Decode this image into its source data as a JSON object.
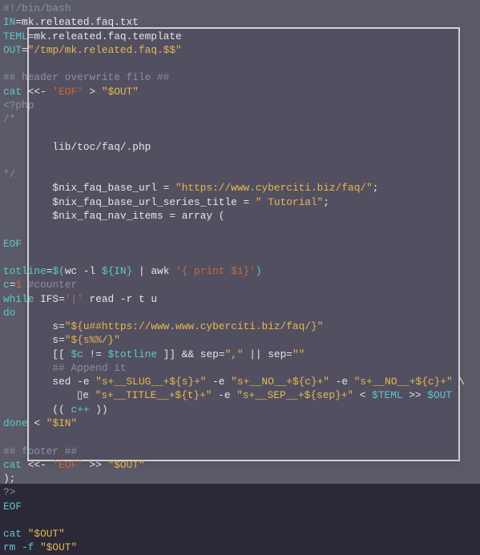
{
  "code": {
    "l01": "#!/bin/bash",
    "l02a": "IN",
    "l02b": "=mk.releated.faq.txt",
    "l03a": "TEML",
    "l03b": "=mk.releated.faq.template",
    "l04a": "OUT",
    "l04b": "=",
    "l04c": "\"/tmp/mk.releated.faq.$$\"",
    "l05": "",
    "l06": "## header overwrite file ##",
    "l07a": "cat ",
    "l07b": "<<- ",
    "l07c": "'EOF'",
    "l07d": " > ",
    "l07e": "\"$OUT\"",
    "l08": "<?php",
    "l09": "/*",
    "l10": "",
    "l11": "        lib/toc/faq/.php",
    "l12": "",
    "l13": "*/",
    "l14a": "        $nix_faq_base_url = ",
    "l14b": "\"https://www.cyberciti.biz/faq/\"",
    "l14c": ";",
    "l15a": "        $nix_faq_base_url_series_title = ",
    "l15b": "\" Tutorial\"",
    "l15c": ";",
    "l16": "        $nix_faq_nav_items = array (",
    "l17": "",
    "l18": "EOF",
    "l19": "",
    "l20a": "totline",
    "l20b": "=",
    "l20c": "$(",
    "l20d": "wc -l ",
    "l20e": "${IN}",
    "l20f": " | ",
    "l20g": "awk ",
    "l20h": "'{ print $1}'",
    "l20i": ")",
    "l21a": "c",
    "l21b": "=",
    "l21c": "1",
    "l21d": " #counter",
    "l22a": "while ",
    "l22b": "IFS=",
    "l22c": "'|'",
    "l22d": " read -r t u",
    "l23": "do",
    "l24a": "        s=",
    "l24b": "\"${u##https://www.www.cyberciti.biz/faq/}\"",
    "l25a": "        s=",
    "l25b": "\"${s%%/}\"",
    "l26a": "        [[ ",
    "l26b": "$c",
    "l26c": " != ",
    "l26d": "$totline",
    "l26e": " ]] && ",
    "l26f": "sep=",
    "l26g": "\",\"",
    "l26h": " || ",
    "l26i": "sep=",
    "l26j": "\"\"",
    "l27": "        ## Append it",
    "l28a": "        sed -e ",
    "l28b": "\"s+__SLUG__+${s}+\"",
    "l28c": " -e ",
    "l28d": "\"s+__NO__+${c}+\"",
    "l28e": " -e ",
    "l28f": "\"s+__NO__+${c}+\"",
    "l28g": " \\",
    "l29a": "            -e ",
    "l29b": "\"s+__TITLE__+${t}+\"",
    "l29c": " -e ",
    "l29d": "\"s+__SEP__+${sep}+\"",
    "l29e": " < ",
    "l29f": "$TEML",
    "l29g": " >> ",
    "l29h": "$OUT",
    "l30a": "        (( ",
    "l30b": "c++",
    "l30c": " ))",
    "l31a": "done ",
    "l31b": "< ",
    "l31c": "\"$IN\"",
    "l32": "",
    "l33": "## footer ##",
    "l34a": "cat ",
    "l34b": "<<- ",
    "l34c": "'EOF'",
    "l34d": " >> ",
    "l34e": "\"$OUT\"",
    "l35": ");",
    "l36": "?>",
    "l37": "EOF",
    "l38": "",
    "l39a": "cat ",
    "l39b": "\"$OUT\"",
    "l40a": "rm -f ",
    "l40b": "\"$OUT\""
  },
  "cursor_box": "▯"
}
